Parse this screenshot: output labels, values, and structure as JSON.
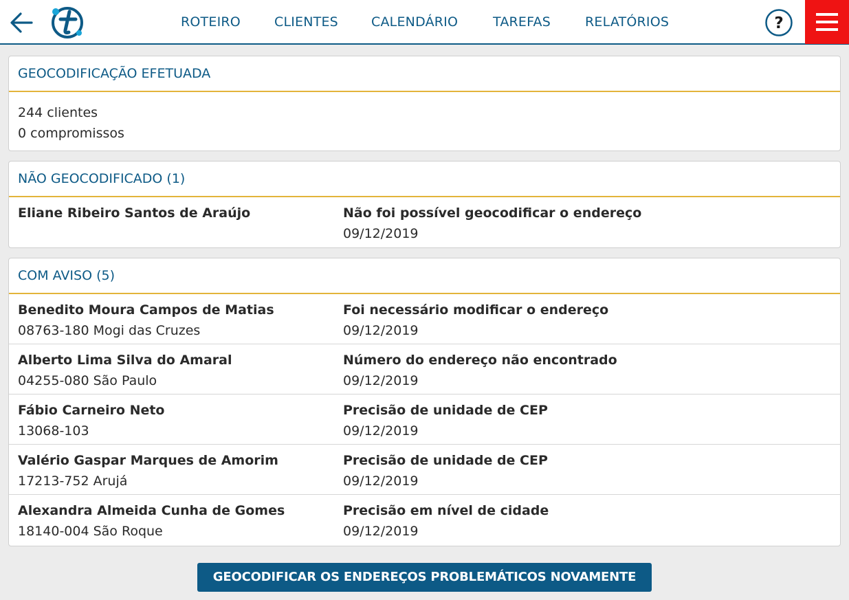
{
  "nav": {
    "items": [
      "ROTEIRO",
      "CLIENTES",
      "CALENDÁRIO",
      "TAREFAS",
      "RELATÓRIOS"
    ],
    "help_label": "?"
  },
  "colors": {
    "brand": "#0d5a86",
    "accent": "#e3b43a",
    "menu": "#ef1313"
  },
  "icons": [
    "back-arrow-icon",
    "app-logo-icon",
    "help-icon",
    "hamburger-menu-icon"
  ],
  "geocoded": {
    "title": "GEOCODIFICAÇÃO EFETUADA",
    "clients": "244 clientes",
    "appointments": "0 compromissos"
  },
  "not_geocoded": {
    "title": "NÃO GEOCODIFICADO (1)",
    "rows": [
      {
        "name": "Eliane Ribeiro Santos de Araújo",
        "address": "",
        "message": "Não foi possível geocodificar o endereço",
        "date": "09/12/2019"
      }
    ]
  },
  "warnings": {
    "title": "COM AVISO (5)",
    "rows": [
      {
        "name": "Benedito Moura Campos de Matias",
        "address": "08763-180 Mogi das Cruzes",
        "message": "Foi necessário modificar o endereço",
        "date": "09/12/2019"
      },
      {
        "name": "Alberto Lima Silva do Amaral",
        "address": "04255-080 São Paulo",
        "message": "Número do endereço não encontrado",
        "date": "09/12/2019"
      },
      {
        "name": "Fábio Carneiro Neto",
        "address": "13068-103",
        "message": "Precisão de unidade de CEP",
        "date": "09/12/2019"
      },
      {
        "name": "Valério Gaspar Marques de Amorim",
        "address": "17213-752 Arujá",
        "message": "Precisão de unidade de CEP",
        "date": "09/12/2019"
      },
      {
        "name": "Alexandra Almeida Cunha de Gomes",
        "address": "18140-004 São Roque",
        "message": "Precisão em nível de cidade",
        "date": "09/12/2019"
      }
    ]
  },
  "action_button": "GEOCODIFICAR OS ENDEREÇOS PROBLEMÁTICOS NOVAMENTE"
}
